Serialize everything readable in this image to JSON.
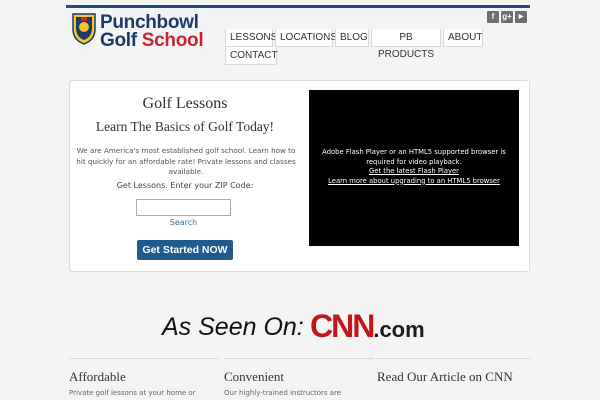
{
  "header": {
    "logo_line1": "Punchbowl",
    "logo_line2": "Golf School",
    "social": [
      {
        "icon": "facebook-icon",
        "glyph": "f"
      },
      {
        "icon": "google-plus-icon",
        "glyph": "g+"
      },
      {
        "icon": "youtube-icon",
        "glyph": "▶"
      }
    ]
  },
  "nav": {
    "items": [
      "LESSONS",
      "LOCATIONS",
      "BLOG",
      "PB PRODUCTS",
      "ABOUT",
      "CONTACT"
    ]
  },
  "hero": {
    "title": "Golf Lessons",
    "subtitle": "Learn The Basics of Golf Today!",
    "description": "We are America's most established golf school. Learn how to hit quickly for an affordable rate! Private lessons and classes available.",
    "zip_prompt": "Get Lessons. Enter your ZIP Code:",
    "zip_value": "",
    "search_label": "Search",
    "cta_label": "Get Started NOW"
  },
  "video": {
    "message": "Adobe Flash Player or an HTML5 supported browser is required for video playback.",
    "link1": "Get the latest Flash Player",
    "link2": "Learn more about upgrading to an HTML5 browser"
  },
  "as_seen": {
    "label": "As Seen On:",
    "brand": "CNN",
    "brand_suffix": ".com"
  },
  "columns": [
    {
      "title": "Affordable",
      "text": "Private golf lessons at your home or"
    },
    {
      "title": "Convenient",
      "text": "Our highly-trained instructors are"
    },
    {
      "title": "Read Our Article on CNN",
      "text": ""
    }
  ],
  "colors": {
    "brand_blue": "#1d4f8a",
    "cta_blue": "#1f5b8f",
    "cnn_red": "#c4151c"
  }
}
